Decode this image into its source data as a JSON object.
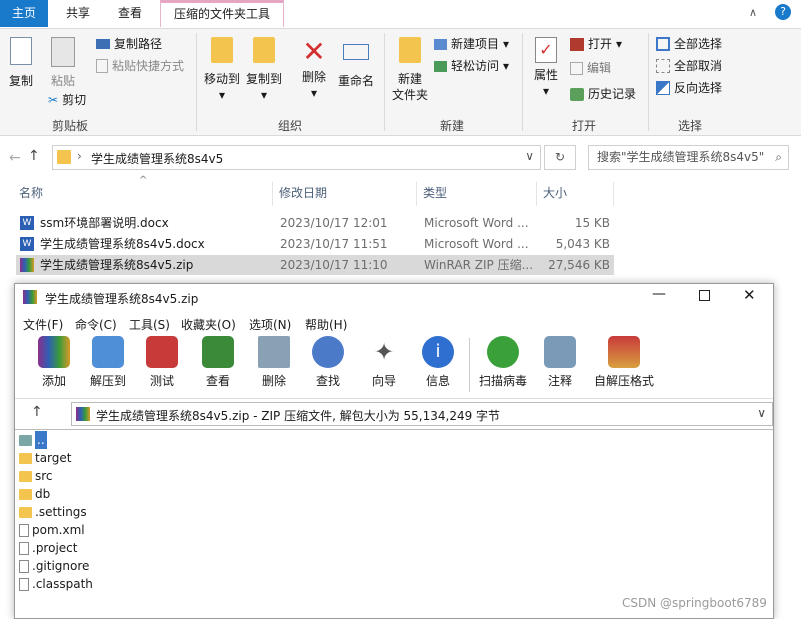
{
  "tabs": {
    "home": "主页",
    "share": "共享",
    "view": "查看",
    "tools": "压缩的文件夹工具"
  },
  "ribbon": {
    "copy": "复制",
    "paste": "粘贴",
    "copy_path": "复制路径",
    "paste_shortcut": "粘贴快捷方式",
    "cut": "剪切",
    "clipboard": "剪贴板",
    "move_to": "移动到",
    "copy_to": "复制到",
    "delete": "删除",
    "rename": "重命名",
    "organize": "组织",
    "new_folder_1": "新建",
    "new_folder_2": "文件夹",
    "new_item": "新建项目",
    "easy_access": "轻松访问",
    "new_group": "新建",
    "properties": "属性",
    "open": "打开",
    "edit": "编辑",
    "history": "历史记录",
    "open_group": "打开",
    "select_all": "全部选择",
    "select_none": "全部取消",
    "invert": "反向选择",
    "select_group": "选择"
  },
  "address": {
    "path": "学生成绩管理系统8s4v5",
    "search": "搜索\"学生成绩管理系统8s4v5\""
  },
  "columns": {
    "name": "名称",
    "date": "修改日期",
    "type": "类型",
    "size": "大小"
  },
  "files": [
    {
      "name": "ssm环境部署说明.docx",
      "date": "2023/10/17 12:01",
      "type": "Microsoft Word ...",
      "size": "15 KB"
    },
    {
      "name": "学生成绩管理系统8s4v5.docx",
      "date": "2023/10/17 11:51",
      "type": "Microsoft Word ...",
      "size": "5,043 KB"
    },
    {
      "name": "学生成绩管理系统8s4v5.zip",
      "date": "2023/10/17 11:10",
      "type": "WinRAR ZIP 压缩...",
      "size": "27,546 KB"
    }
  ],
  "winrar": {
    "title": "学生成绩管理系统8s4v5.zip",
    "menu": [
      "文件(F)",
      "命令(C)",
      "工具(S)",
      "收藏夹(O)",
      "选项(N)",
      "帮助(H)"
    ],
    "toolbar": [
      "添加",
      "解压到",
      "测试",
      "查看",
      "删除",
      "查找",
      "向导",
      "信息",
      "扫描病毒",
      "注释",
      "自解压格式"
    ],
    "path": "学生成绩管理系统8s4v5.zip - ZIP 压缩文件, 解包大小为 55,134,249 字节",
    "tree": [
      "..",
      "target",
      "src",
      "db",
      ".settings",
      "pom.xml",
      ".project",
      ".gitignore",
      ".classpath"
    ]
  },
  "watermark": "CSDN @springboot6789",
  "colors": {
    "accent": "#1979ca",
    "folder": "#f4c54e",
    "select": "#cce8ff"
  }
}
